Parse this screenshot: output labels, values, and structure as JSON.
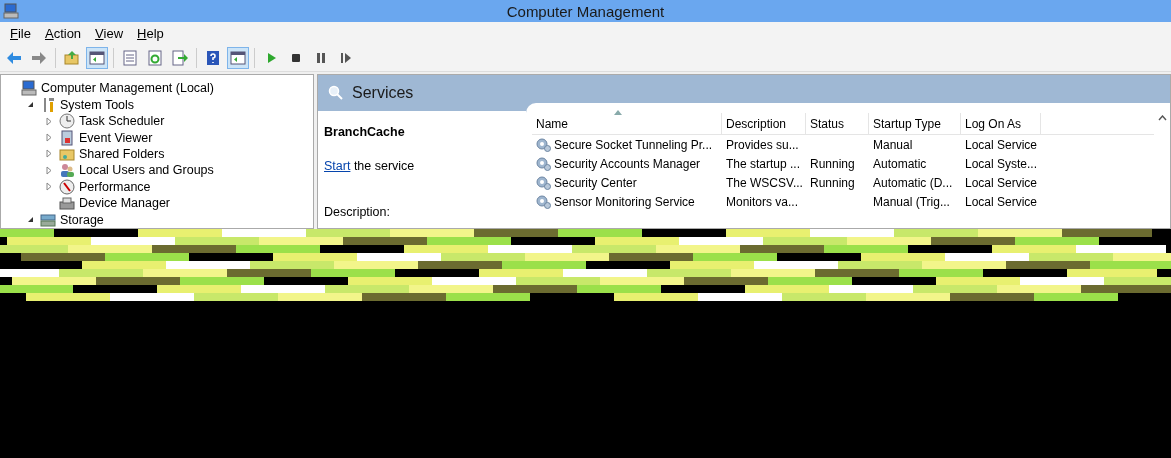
{
  "window": {
    "title": "Computer Management"
  },
  "menu": [
    "File",
    "Action",
    "View",
    "Help"
  ],
  "toolbar": [
    {
      "pressed": false
    },
    {
      "pressed": false
    },
    {
      "pressed": false
    },
    {
      "pressed": true
    },
    {
      "pressed": false
    },
    {
      "pressed": false
    },
    {
      "pressed": false
    },
    {
      "pressed": false
    },
    {
      "pressed": true
    },
    {
      "pressed": false
    },
    {
      "pressed": false
    },
    {
      "pressed": false
    },
    {
      "pressed": false
    }
  ],
  "tree": [
    {
      "label": "Computer Management (Local)",
      "has_children": false,
      "children": [
        {
          "label": "System Tools",
          "has_children": true,
          "expanded": true,
          "children": [
            {
              "label": "Task Scheduler",
              "has_children": true,
              "expanded": false
            },
            {
              "label": "Event Viewer",
              "has_children": true,
              "expanded": false
            },
            {
              "label": "Shared Folders",
              "has_children": true,
              "expanded": false
            },
            {
              "label": "Local Users and Groups",
              "has_children": true,
              "expanded": false
            },
            {
              "label": "Performance",
              "has_children": true,
              "expanded": false
            },
            {
              "label": "Device Manager",
              "has_children": false
            }
          ]
        },
        {
          "label": "Storage",
          "has_children": true,
          "expanded": true
        }
      ]
    }
  ],
  "services": {
    "header": "Services",
    "detail": {
      "name": "BranchCache",
      "action_link": "Start",
      "action_rest": " the service",
      "description_label": "Description:"
    },
    "table": {
      "columns": [
        {
          "label": "Name",
          "sorted": true
        },
        {
          "label": "Description",
          "sorted": false
        },
        {
          "label": "Status",
          "sorted": false
        },
        {
          "label": "Startup Type",
          "sorted": false
        },
        {
          "label": "Log On As",
          "sorted": false
        }
      ],
      "rows": [
        [
          "Secure Socket Tunneling Pr...",
          "Provides su...",
          "",
          "Manual",
          "Local Service"
        ],
        [
          "Security Accounts Manager",
          "The startup ...",
          "Running",
          "Automatic",
          "Local Syste..."
        ],
        [
          "Security Center",
          "The WSCSV...",
          "Running",
          "Automatic (D...",
          "Local Service"
        ],
        [
          "Sensor Monitoring Service",
          "Monitors va...",
          "",
          "Manual (Trig...",
          "Local Service"
        ]
      ]
    }
  }
}
